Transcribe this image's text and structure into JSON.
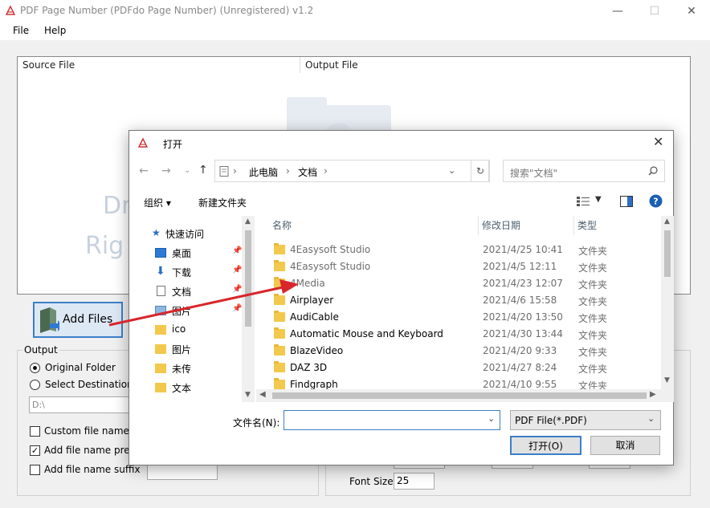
{
  "window": {
    "title": "PDF Page Number  (PDFdo Page Number)  (Unregistered) v1.2",
    "minimize": "—",
    "maximize": "☐",
    "close": "✕"
  },
  "menu": {
    "file": "File",
    "help": "Help"
  },
  "file_list": {
    "col_source": "Source File",
    "col_output": "Output File",
    "drop_line1": "Dr",
    "drop_line2": "Rig"
  },
  "add_files": {
    "label": "Add Files"
  },
  "output": {
    "title": "Output",
    "original_folder": "Original Folder",
    "select_destination": "Select Destination F",
    "path": "D:\\",
    "custom_file_name": "Custom file name",
    "add_prefix": "Add file name prefix",
    "add_suffix": "Add file name suffix",
    "add_prefix_checked": true
  },
  "font_size": {
    "label": "Font Size",
    "value": "25"
  },
  "dialog": {
    "title": "打开",
    "close": "✕",
    "breadcrumb": [
      "此电脑",
      "文档"
    ],
    "search_placeholder": "搜索\"文档\"",
    "organize": "组织 ▾",
    "new_folder": "新建文件夹",
    "nav": [
      {
        "label": "快速访问",
        "icon": "star-icon",
        "pinned": false
      },
      {
        "label": "桌面",
        "icon": "desktop-icon",
        "pinned": true
      },
      {
        "label": "下载",
        "icon": "download-icon",
        "pinned": true
      },
      {
        "label": "文档",
        "icon": "document-icon",
        "pinned": true
      },
      {
        "label": "图片",
        "icon": "picture-icon",
        "pinned": true
      },
      {
        "label": "ico",
        "icon": "folder-icon",
        "pinned": false
      },
      {
        "label": "图片",
        "icon": "folder-icon",
        "pinned": false
      },
      {
        "label": "未传",
        "icon": "folder-icon",
        "pinned": false
      },
      {
        "label": "文本",
        "icon": "folder-icon",
        "pinned": false
      }
    ],
    "columns": {
      "name": "名称",
      "date": "修改日期",
      "type": "类型"
    },
    "files": [
      {
        "name": "4Easysoft Studio",
        "date": "2021/4/25 10:41",
        "type": "文件夹"
      },
      {
        "name": "4Easysoft Studio",
        "date": "2021/4/5 12:11",
        "type": "文件夹"
      },
      {
        "name": "4Media",
        "date": "2021/4/23 12:07",
        "type": "文件夹"
      },
      {
        "name": "Airplayer",
        "date": "2021/4/6 15:58",
        "type": "文件夹"
      },
      {
        "name": "AudiCable",
        "date": "2021/4/20 13:50",
        "type": "文件夹"
      },
      {
        "name": "Automatic Mouse and Keyboard",
        "date": "2021/4/30 13:44",
        "type": "文件夹"
      },
      {
        "name": "BlazeVideo",
        "date": "2021/4/20 9:33",
        "type": "文件夹"
      },
      {
        "name": "DAZ 3D",
        "date": "2021/4/27 8:24",
        "type": "文件夹"
      },
      {
        "name": "Findgraph",
        "date": "2021/4/10 9:55",
        "type": "文件夹"
      }
    ],
    "filename_label": "文件名(N):",
    "filename_value": "",
    "filetype": "PDF File(*.PDF)",
    "open_button": "打开(O)",
    "cancel_button": "取消"
  },
  "colors": {
    "accent": "#3c7fc8",
    "arrow": "#d9262b",
    "folder": "#f2c94c"
  }
}
